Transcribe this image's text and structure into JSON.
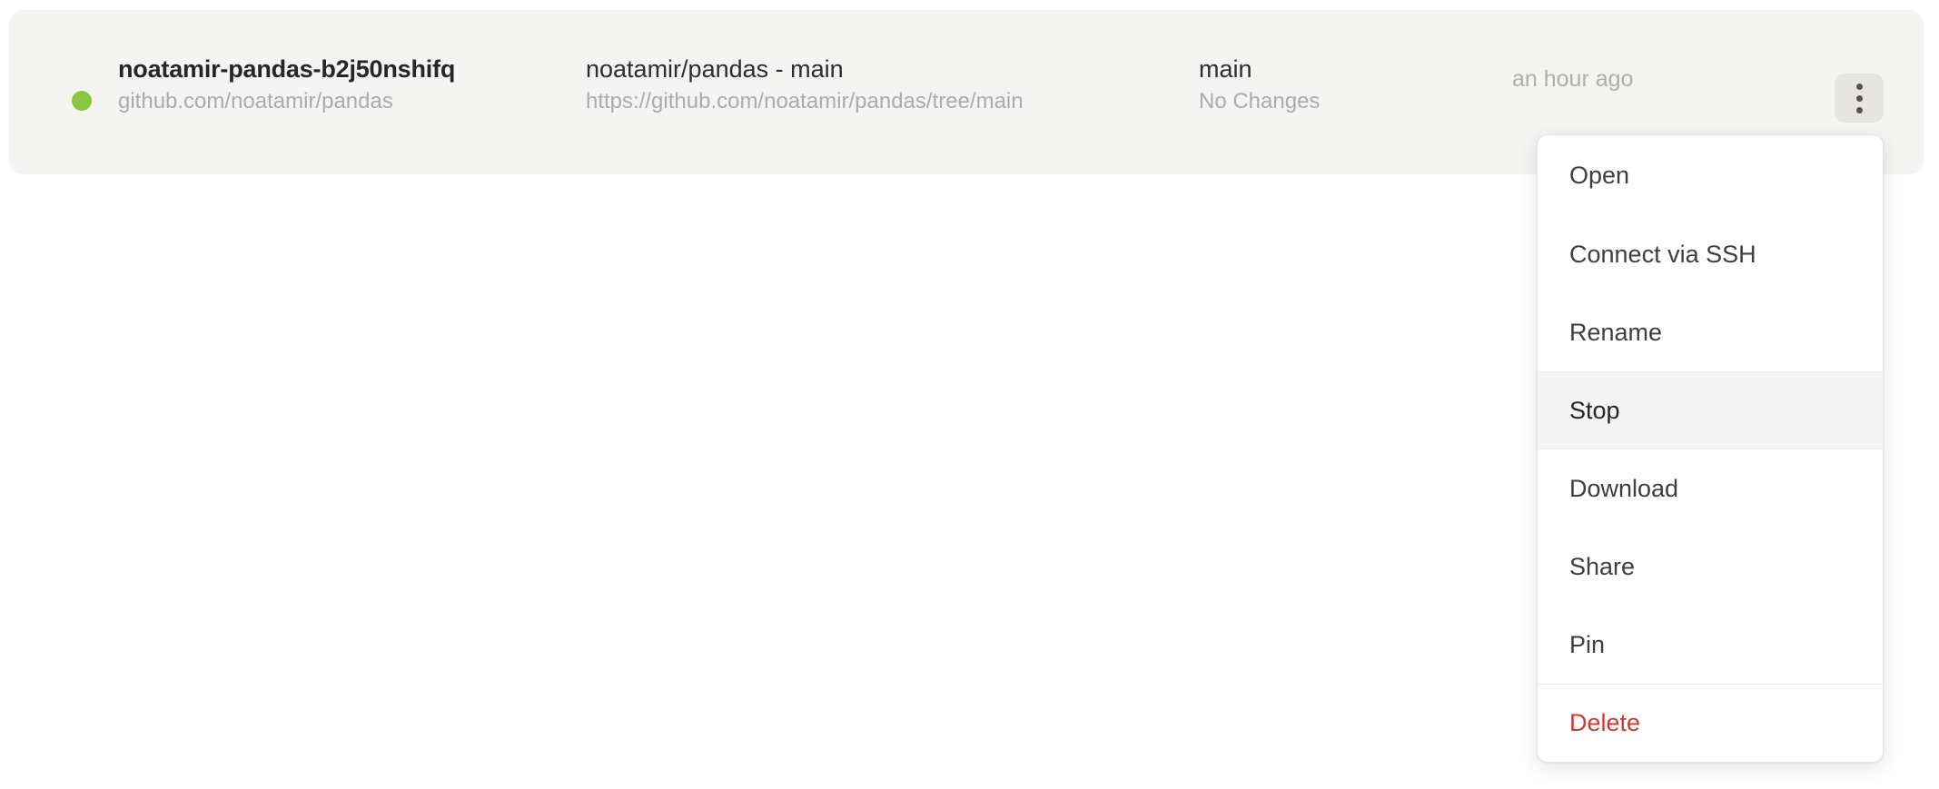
{
  "workspace_row": {
    "status": {
      "icon": "status-dot-icon",
      "color": "#8cc63e",
      "state": "running"
    },
    "name": "noatamir-pandas-b2j50nshifq",
    "host": "github.com/noatamir/pandas",
    "repo_title": "noatamir/pandas - main",
    "repo_url": "https://github.com/noatamir/pandas/tree/main",
    "branch": "main",
    "changes": "No Changes",
    "updated": "an hour ago",
    "menu_button_icon": "kebab-menu-icon"
  },
  "context_menu": {
    "items": [
      {
        "label": "Open",
        "name": "open",
        "highlighted": false,
        "danger": false
      },
      {
        "label": "Connect via SSH",
        "name": "connect-via-ssh",
        "highlighted": false,
        "danger": false
      },
      {
        "label": "Rename",
        "name": "rename",
        "highlighted": false,
        "danger": false
      },
      {
        "label": "Stop",
        "name": "stop",
        "highlighted": true,
        "danger": false
      },
      {
        "label": "Download",
        "name": "download",
        "highlighted": false,
        "danger": false
      },
      {
        "label": "Share",
        "name": "share",
        "highlighted": false,
        "danger": false
      },
      {
        "label": "Pin",
        "name": "pin",
        "highlighted": false,
        "danger": false
      },
      {
        "label": "Delete",
        "name": "delete",
        "highlighted": false,
        "danger": true
      }
    ],
    "danger_color": "#cf3a30",
    "highlight_color": "#f4f4f4"
  }
}
